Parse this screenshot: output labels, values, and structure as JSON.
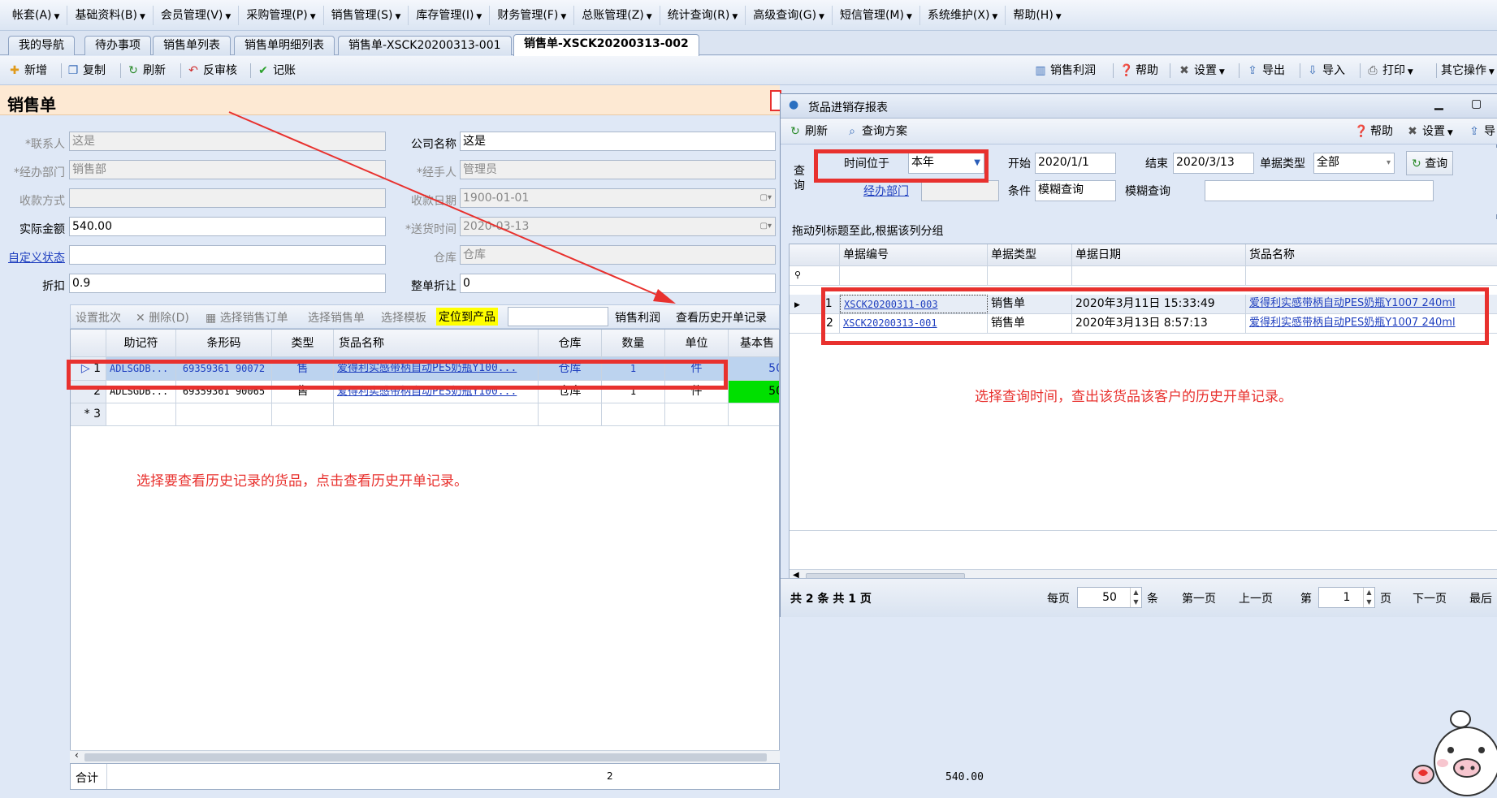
{
  "menubar": {
    "items": [
      {
        "label": "帐套(A)"
      },
      {
        "label": "基础资料(B)"
      },
      {
        "label": "会员管理(V)"
      },
      {
        "label": "采购管理(P)"
      },
      {
        "label": "销售管理(S)"
      },
      {
        "label": "库存管理(I)"
      },
      {
        "label": "财务管理(F)"
      },
      {
        "label": "总账管理(Z)"
      },
      {
        "label": "统计查询(R)"
      },
      {
        "label": "高级查询(G)"
      },
      {
        "label": "短信管理(M)"
      },
      {
        "label": "系统维护(X)"
      },
      {
        "label": "帮助(H)"
      }
    ]
  },
  "tabs": [
    "我的导航",
    "待办事项",
    "销售单列表",
    "销售单明细列表",
    "销售单-XSCK20200313-001",
    "销售单-XSCK20200313-002"
  ],
  "toolbar": {
    "new": "新增",
    "copy": "复制",
    "refresh": "刷新",
    "unaudit": "反审核",
    "post": "记账",
    "profit": "销售利润",
    "help": "帮助",
    "settings": "设置",
    "export": "导出",
    "import": "导入",
    "print": "打印",
    "other": "其它操作"
  },
  "form": {
    "title": "销售单",
    "contact_label": "*联系人",
    "contact": "这是",
    "company_label": "公司名称",
    "company": "这是",
    "dept_label": "*经办部门",
    "dept": "销售部",
    "handler_label": "*经手人",
    "handler": "管理员",
    "paymethod_label": "收款方式",
    "paymethod": "",
    "paydate_label": "收款日期",
    "paydate": "1900-01-01",
    "amount_label": "实际金额",
    "amount": "540.00",
    "delivery_label": "*送货时间",
    "delivery": "2020-03-13",
    "custom_label": "自定义状态",
    "custom": "",
    "warehouse_label": "仓库",
    "warehouse": "仓库",
    "discount_label": "折扣",
    "discount": "0.9",
    "wholediscount_label": "整单折让",
    "wholediscount": "0"
  },
  "gridbar": {
    "batch": "设置批次",
    "delete": "删除(D)",
    "select_order": "选择销售订单",
    "select_sale": "选择销售单",
    "select_template": "选择模板",
    "locate": "定位到产品",
    "locate_value": "",
    "profit": "销售利润",
    "history": "查看历史开单记录"
  },
  "grid": {
    "headers": [
      "助记符",
      "条形码",
      "类型",
      "货品名称",
      "仓库",
      "数量",
      "单位",
      "基本售"
    ],
    "rows": [
      {
        "no": "1",
        "code": "ADLSGDB...",
        "barcode": "69359361 90072",
        "type": "售",
        "name": "爱得利实感带柄自动PES奶瓶Y100...",
        "wh": "仓库",
        "qty": "1",
        "unit": "件",
        "price": "50"
      },
      {
        "no": "2",
        "code": "ADLSGDB...",
        "barcode": "69359361 90065",
        "type": "售",
        "name": "爱得利实感带柄自动PES奶瓶Y100...",
        "wh": "仓库",
        "qty": "1",
        "unit": "件",
        "price": "50"
      }
    ],
    "new_row_no": "3",
    "total_label": "合计",
    "total_qty": "2",
    "total_amount": "540.00"
  },
  "report": {
    "title": "货品进销存报表",
    "refresh": "刷新",
    "scheme": "查询方案",
    "help": "帮助",
    "settings": "设置",
    "export": "导",
    "query_label": "查询",
    "time_label": "时间位于",
    "time_value": "本年",
    "start_label": "开始",
    "start": "2020/1/1",
    "end_label": "结束",
    "end": "2020/3/13",
    "billtype_label": "单据类型",
    "billtype": "全部",
    "query_btn": "查询",
    "dept_label": "经办部门",
    "dept": "",
    "cond_label": "条件",
    "cond": "模糊查询",
    "fuzzy_label": "模糊查询",
    "fuzzy": "",
    "group_hint": "拖动列标题至此,根据该列分组",
    "headers": [
      "单据编号",
      "单据类型",
      "单据日期",
      "货品名称"
    ],
    "rows": [
      {
        "no": "1",
        "bill": "XSCK20200311-003",
        "type": "销售单",
        "date": "2020年3月11日 15:33:49",
        "name": "爱得利实感带柄自动PES奶瓶Y1007 240ml"
      },
      {
        "no": "2",
        "bill": "XSCK20200313-001",
        "type": "销售单",
        "date": "2020年3月13日 8:57:13",
        "name": "爱得利实感带柄自动PES奶瓶Y1007 240ml"
      }
    ],
    "footer": {
      "count": "共 2 条  共 1 页",
      "per_page": "每页",
      "per_value": "50",
      "per_unit": "条",
      "first": "第一页",
      "prev": "上一页",
      "page_pre": "第",
      "page_value": "1",
      "page_post": "页",
      "next": "下一页",
      "last": "最后"
    }
  },
  "annotations": {
    "left_note": "选择要查看历史记录的货品，点击查看历史开单记录。",
    "right_note": "选择查询时间，查出该货品该客户的历史开单记录。"
  },
  "colors": {
    "accent_red": "#e8312e",
    "title_bg": "#fde9d3",
    "highlight_yellow": "#ffff00",
    "green_cell": "#00e000"
  }
}
